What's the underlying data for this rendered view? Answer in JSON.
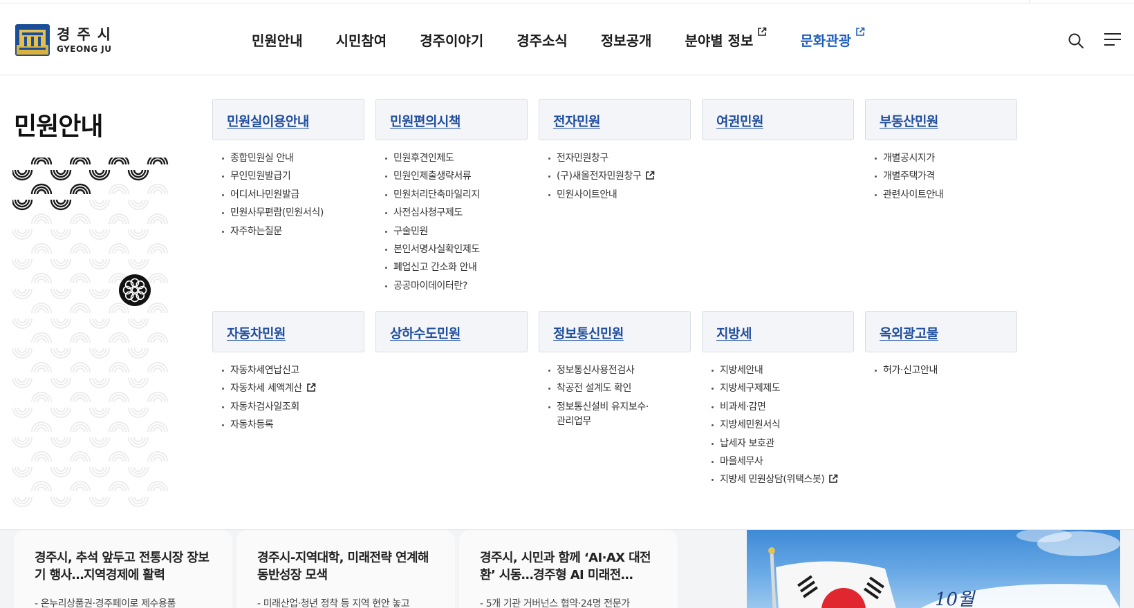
{
  "site": {
    "logo_ko": "경주시",
    "logo_en": "GYEONG JU"
  },
  "gnb": [
    {
      "label": "민원안내",
      "external": false,
      "active": false
    },
    {
      "label": "시민참여",
      "external": false,
      "active": false
    },
    {
      "label": "경주이야기",
      "external": false,
      "active": false
    },
    {
      "label": "경주소식",
      "external": false,
      "active": false
    },
    {
      "label": "정보공개",
      "external": false,
      "active": false
    },
    {
      "label": "분야별 정보",
      "external": true,
      "active": false
    },
    {
      "label": "문화관광",
      "external": true,
      "active": true
    }
  ],
  "header_icons": [
    "search-icon",
    "menu-icon"
  ],
  "panel": {
    "title": "민원안내",
    "sections": [
      {
        "title": "민원실이용안내",
        "items": [
          "종합민원실 안내",
          "무인민원발급기",
          "어디서나민원발급",
          "민원사무편람(민원서식)",
          "자주하는질문"
        ]
      },
      {
        "title": "민원편의시책",
        "items": [
          "민원후견인제도",
          "민원인제출생략서류",
          "민원처리단축마일리지",
          "사전심사청구제도",
          "구술민원",
          "본인서명사실확인제도",
          "폐업신고 간소화 안내",
          "공공마이데이터란?"
        ]
      },
      {
        "title": "전자민원",
        "items": [
          "전자민원창구",
          "(구)새올전자민원창구",
          "민원사이트안내"
        ]
      },
      {
        "title": "여권민원",
        "items": []
      },
      {
        "title": "부동산민원",
        "items": [
          "개별공시지가",
          "개별주택가격",
          "관련사이트안내"
        ]
      },
      {
        "title": "자동차민원",
        "items": [
          "자동차세연납신고",
          "자동차세 세액계산",
          "자동차검사일조회",
          "자동차등록"
        ]
      },
      {
        "title": "상하수도민원",
        "items": []
      },
      {
        "title": "정보통신민원",
        "items": [
          "정보통신사용전검사",
          "착공전 설계도 확인",
          "정보통신설비 유지보수·관리업무"
        ]
      },
      {
        "title": "지방세",
        "items": [
          "지방세안내",
          "지방세구제제도",
          "비과세·감면",
          "지방세민원서식",
          "납세자 보호관",
          "마을세무사",
          "지방세 민원상담(위택스봇)"
        ]
      },
      {
        "title": "옥외광고물",
        "items": [
          "허가·신고안내"
        ]
      }
    ]
  },
  "news": [
    {
      "title": "경주시, 추석 앞두고 전통시장 장보기 행사…지역경제에 활력",
      "sub": "- 온누리상품권·경주페이로 제수용품"
    },
    {
      "title": "경주시-지역대학, 미래전략 연계해 동반성장 모색",
      "sub": "- 미래산업·청년 정착 등 지역 현안 놓고"
    },
    {
      "title": "경주시, 시민과 함께 ‘AI·AX 대전환’ 시동…경주형 AI 미래전…",
      "sub": "- 5개 기관 거버넌스 협약·24명 전문가"
    }
  ],
  "banner": {
    "text": "10월"
  }
}
